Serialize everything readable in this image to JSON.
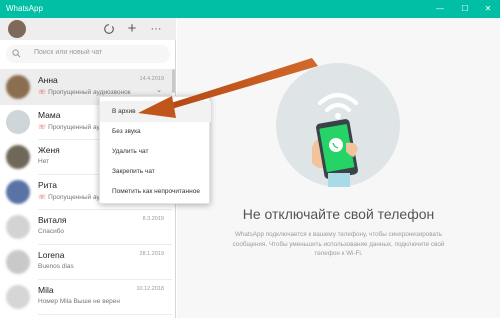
{
  "window": {
    "title": "WhatsApp",
    "minimize": "—",
    "maximize": "☐",
    "close": "✕"
  },
  "header": {
    "status_icon": "status-icon",
    "new_chat_icon": "+",
    "menu_icon": "···"
  },
  "search": {
    "placeholder": "Поиск или новый чат"
  },
  "chats": [
    {
      "name": "Анна",
      "date": "14.4.2019",
      "missed": true,
      "preview": "Пропущенный аудиозвонок",
      "avatar_color": "#8b6d4f",
      "active": true
    },
    {
      "name": "Мама",
      "date": "",
      "missed": true,
      "preview": "Пропущенный ау",
      "avatar_color": "#cfd6d9",
      "active": false
    },
    {
      "name": "Женя",
      "date": "",
      "missed": false,
      "preview": "Нет",
      "avatar_color": "#6f6758",
      "active": false
    },
    {
      "name": "Рита",
      "date": "",
      "missed": true,
      "preview": "Пропущенный ау",
      "avatar_color": "#5a72a6",
      "active": false
    },
    {
      "name": "Виталя",
      "date": "8.3.2019",
      "missed": false,
      "preview": "Спасибо",
      "avatar_color": "#d3d3d3",
      "active": false
    },
    {
      "name": "Lorena",
      "date": "28.1.2019",
      "missed": false,
      "preview": "Buenos dias",
      "avatar_color": "#c9c9c9",
      "active": false
    },
    {
      "name": "Mila",
      "date": "10.12.2018",
      "missed": false,
      "preview": "Номер Mila Выше не верен",
      "avatar_color": "#d6d6d6",
      "active": false
    }
  ],
  "context_menu": {
    "items": [
      "В архив",
      "Без звука",
      "Удалить чат",
      "Закрепить чат",
      "Пометить как непрочитанное"
    ]
  },
  "main": {
    "heading": "Не отключайте свой телефон",
    "description": "WhatsApp подключается к вашему телефону, чтобы синхронизировать сообщения. Чтобы уменьшить использование данных, подключите свой телефон к Wi-Fi."
  },
  "colors": {
    "accent": "#00bfa5",
    "arrow": "#c1561c",
    "whatsapp_green": "#25d366"
  }
}
